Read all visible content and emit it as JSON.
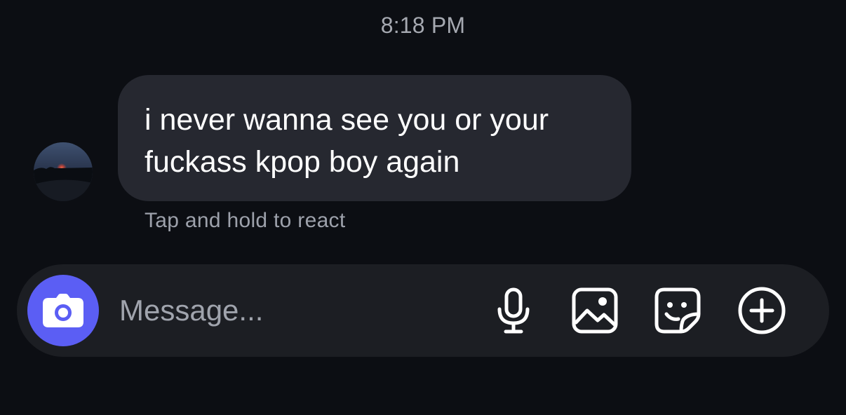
{
  "chat": {
    "timestamp": "8:18 PM",
    "message_line_1": "i never wanna see you or your",
    "message_line_2": "fuckass kpop boy again",
    "react_hint": "Tap and hold to react"
  },
  "composer": {
    "placeholder": "Message...",
    "icons": [
      "camera-icon",
      "microphone-icon",
      "gallery-icon",
      "sticker-icon",
      "plus-circle-icon"
    ]
  },
  "colors": {
    "background": "#0c0e13",
    "bubble": "#262830",
    "composer": "#1c1e23",
    "camera_button": "#5b5ef4"
  }
}
